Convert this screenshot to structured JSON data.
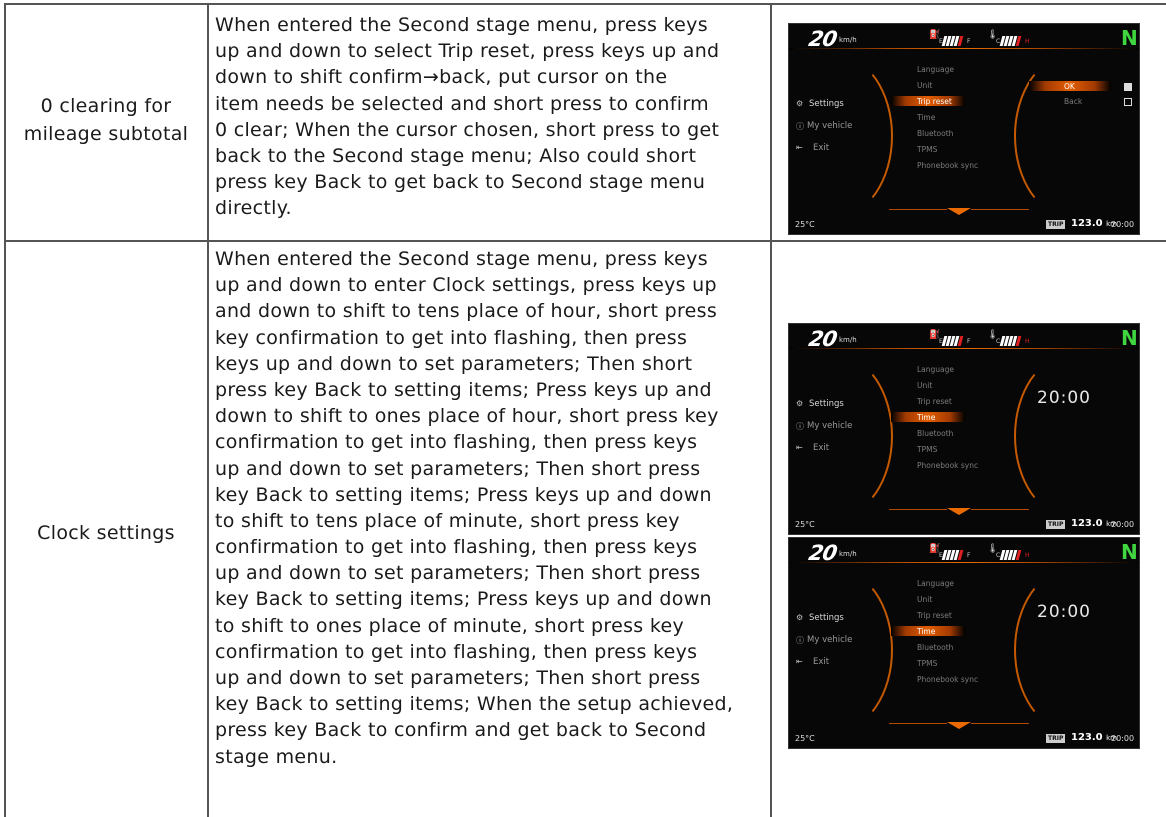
{
  "rows": [
    {
      "title_lines": [
        "0 clearing for",
        "mileage subtotal"
      ],
      "desc_lines": [
        "When entered the Second stage menu, press keys",
        "up and down to select Trip reset, press keys up and",
        "down to shift confirm→back, put cursor on the",
        "item needs be selected and short press to confirm",
        "0 clear; When the cursor chosen, short press to get",
        "back to the Second stage menu;  Also could short",
        "press key Back to get back to Second stage menu",
        "directly."
      ]
    },
    {
      "title_lines": [
        "Clock settings"
      ],
      "desc_lines": [
        "When entered the Second stage menu, press keys",
        "up and down to enter Clock settings, press keys up",
        "and down to shift to tens place of hour, short press",
        "key confirmation to get into flashing, then press",
        "keys up and down to set parameters; Then short",
        "press key Back to setting items; Press keys up and",
        "down to shift to ones place of hour, short press key",
        "confirmation to get into flashing, then press keys",
        "up and down to set parameters; Then short press",
        "key Back to setting items; Press keys up and down",
        "to shift to tens place of minute, short press key",
        "confirmation to get into flashing, then press keys",
        "up and down to set parameters; Then short press",
        "key Back to setting items; Press keys up and down",
        "to shift to ones place of minute, short press key",
        "confirmation to get into flashing, then press keys",
        "up and down to set parameters; Then short press",
        "key Back to setting items; When the setup achieved,",
        "press key Back to confirm and get back to Second",
        "stage menu."
      ]
    }
  ],
  "dashboard": {
    "speed": "20",
    "speed_unit": "km/h",
    "gear": "N",
    "fuel_e": "E",
    "fuel_f": "F",
    "temp_c": "C",
    "temp_h": "H",
    "left_menu": [
      "Settings",
      "My vehicle",
      "Exit"
    ],
    "menu_items": [
      "Language",
      "Unit",
      "Trip reset",
      "Time",
      "Bluetooth",
      "TPMS",
      "Phonebook sync"
    ],
    "temperature": "25°C",
    "trip_label": "TRIP",
    "odometer": "123.0",
    "odometer_unit": "km",
    "clock": "20:00",
    "confirm_options": [
      "OK",
      "Back"
    ],
    "time_display": "20:00"
  }
}
